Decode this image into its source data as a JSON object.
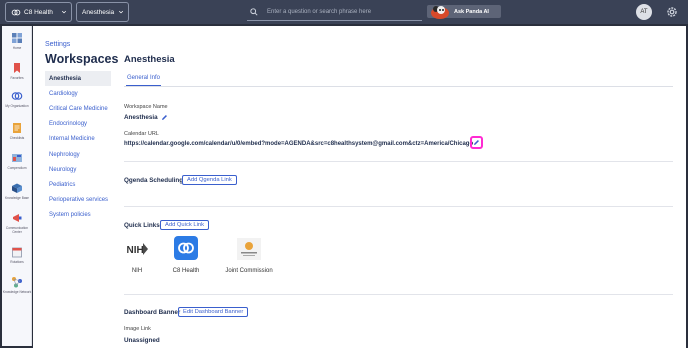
{
  "topbar": {
    "org_name": "C8 Health",
    "workspace_name": "Anesthesia",
    "search_placeholder": "Enter a question or search phrase here",
    "ask_button": "Ask Panda AI",
    "avatar_initials": "AT"
  },
  "rail": [
    {
      "label": "Home",
      "icon": "home-icon"
    },
    {
      "label": "Favorites",
      "icon": "bookmark-icon"
    },
    {
      "label": "My Organization",
      "icon": "organization-icon"
    },
    {
      "label": "Checklists",
      "icon": "checklist-icon"
    },
    {
      "label": "Compendium",
      "icon": "compendium-icon"
    },
    {
      "label": "Knowledge Base",
      "icon": "knowledge-base-icon"
    },
    {
      "label": "Communication Center",
      "icon": "megaphone-icon"
    },
    {
      "label": "Rotations",
      "icon": "calendar-icon"
    },
    {
      "label": "Knowledge Network",
      "icon": "network-icon"
    }
  ],
  "nav": {
    "settings": "Settings",
    "heading": "Workspaces",
    "items": [
      "Anesthesia",
      "Cardiology",
      "Critical Care Medicine",
      "Endocrinology",
      "Internal Medicine",
      "Nephrology",
      "Neurology",
      "Pediatrics",
      "Perioperative services",
      "System policies"
    ],
    "active_index": 0
  },
  "content": {
    "title": "Anesthesia",
    "tab": "General Info",
    "workspace_name_label": "Workspace Name",
    "workspace_name_value": "Anesthesia",
    "calendar_label": "Calendar URL",
    "calendar_value": "https://calendar.google.com/calendar/u/0/embed?mode=AGENDA&src=c8healthsystem@gmail.com&ctz=America/Chicago",
    "qgenda_label": "Qgenda Scheduling",
    "qgenda_button": "Add Qgenda Link",
    "quick_links_label": "Quick Links",
    "quick_links_button": "Add Quick Link",
    "quick_links": [
      {
        "name": "NIH",
        "icon": "nih-logo"
      },
      {
        "name": "C8 Health",
        "icon": "c8-health-logo"
      },
      {
        "name": "Joint Commission",
        "icon": "joint-commission-logo"
      }
    ],
    "banner_label": "Dashboard Banner",
    "banner_button": "Edit Dashboard Banner",
    "image_link_label": "Image Link",
    "image_link_value": "Unassigned"
  },
  "colors": {
    "accent": "#3a5fcd",
    "highlight": "#ff2bd2",
    "topbar": "#3a4256"
  }
}
